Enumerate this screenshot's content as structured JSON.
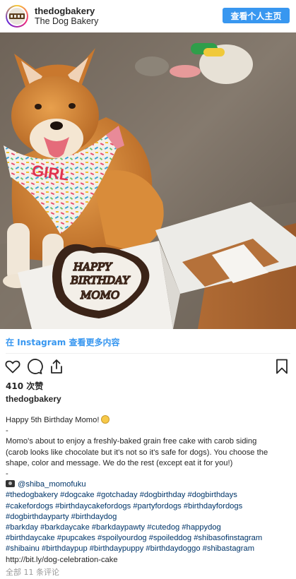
{
  "header": {
    "avatar_text": "thedogbakery",
    "username": "thedogbakery",
    "subname": "The Dog Bakery",
    "profile_button": "查看个人主页"
  },
  "photo": {
    "bandana_text": "GIRL",
    "cake_lines": [
      "HAPPY",
      "BIRTHDAY",
      "MOMO"
    ]
  },
  "view_more": "在 Instagram 查看更多内容",
  "actions": {
    "like_icon": "heart-icon",
    "comment_icon": "comment-icon",
    "share_icon": "share-icon",
    "save_icon": "bookmark-icon"
  },
  "likes": "410 次赞",
  "owner": "thedogbakery",
  "caption": {
    "line1": "Happy 5th Birthday Momo!",
    "dash1": "-",
    "line2": "Momo's about to enjoy a freshly-baked grain free cake with carob siding",
    "line3": "(carob looks like chocolate but it's not so it's safe for dogs). You choose the",
    "line4": "shape, color and message. We do the rest (except eat it for you!)",
    "dash2": "-",
    "credit": "@shiba_momofuku",
    "tags1": "#thedogbakery #dogcake #gotchaday #dogbirthday #dogbirthdays",
    "tags2": "#cakefordogs #birthdaycakefordogs #partyfordogs #birthdayfordogs",
    "tags3": "#dogbirthdayparty #birthdaydog",
    "tags4": "#barkday #barkdaycake #barkdaypawty #cutedog #happydog",
    "tags5": "#birthdaycake #pupcakes #spoilyourdog #spoileddog #shibasofinstagram",
    "tags6": "#shibainu #birthdaypup #birthdaypuppy #birthdaydoggo #shibastagram",
    "link": "http://bit.ly/dog-celebration-cake"
  },
  "comments": "全部 11 条评论",
  "colors": {
    "accent": "#3897f0",
    "hashtag": "#003569"
  }
}
